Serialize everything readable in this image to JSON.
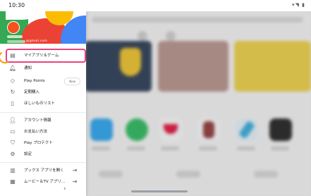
{
  "status_bar": {
    "time": "10:30",
    "system_icons": "▾◥ ▮"
  },
  "account": {
    "email_suffix": "@gmail.com"
  },
  "drawer": {
    "items": [
      {
        "label": "マイアプリ＆ゲーム",
        "icon": "apps-grid-icon",
        "glyph": "▤"
      },
      {
        "label": "通知",
        "icon": "bell-icon",
        "glyph": "🔔︎"
      },
      {
        "label": "Play Points",
        "icon": "play-points-icon",
        "glyph": "◇",
        "badge": "New"
      },
      {
        "label": "定期購入",
        "icon": "subscription-icon",
        "glyph": "↻"
      },
      {
        "label": "ほしいものリスト",
        "icon": "wishlist-icon",
        "glyph": "▯"
      },
      {
        "label": "アカウント情報",
        "icon": "person-icon",
        "glyph": "👤︎"
      },
      {
        "label": "お支払い方法",
        "icon": "credit-card-icon",
        "glyph": "▭"
      },
      {
        "label": "Play プロテクト",
        "icon": "shield-icon",
        "glyph": "⛉"
      },
      {
        "label": "設定",
        "icon": "gear-icon",
        "glyph": "⚙"
      },
      {
        "label": "ブックス アプリを開く",
        "icon": "books-icon",
        "glyph": "▥",
        "trail_icon": "open-external-icon",
        "trail_glyph": "⇥"
      },
      {
        "label": "ムービー＆TV アプリ…",
        "icon": "movies-icon",
        "glyph": "▦",
        "trail_icon": "open-external-icon",
        "trail_glyph": "⇥"
      }
    ]
  },
  "nav": {
    "back_glyph": "‹"
  },
  "colors": {
    "highlight": "#e8457a",
    "pointer": "#f29900"
  }
}
